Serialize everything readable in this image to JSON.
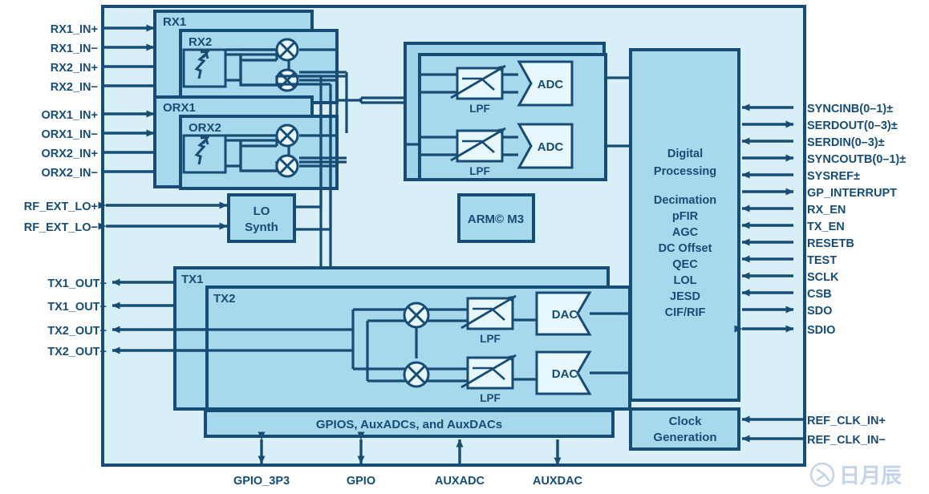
{
  "meta": {
    "title": "RF Transceiver Functional Block Diagram",
    "colors": {
      "outline": "#174c74",
      "die_background": "#d8eff7",
      "block_fill": "#a8d8ec",
      "pale_fill": "#e4f4fb",
      "text": "#174c74",
      "watermark": "#b9cde4",
      "page": "#ffffff"
    }
  },
  "left_inputs": [
    {
      "label": "RX1_IN+",
      "direction": "in"
    },
    {
      "label": "RX1_IN−",
      "direction": "in"
    },
    {
      "label": "RX2_IN+",
      "direction": "in"
    },
    {
      "label": "RX2_IN−",
      "direction": "in"
    },
    {
      "label": "ORX1_IN+",
      "direction": "in"
    },
    {
      "label": "ORX1_IN−",
      "direction": "in"
    },
    {
      "label": "ORX2_IN+",
      "direction": "in"
    },
    {
      "label": "ORX2_IN−",
      "direction": "in"
    }
  ],
  "left_lo": [
    {
      "label": "RF_EXT_LO+",
      "direction": "bidir"
    },
    {
      "label": "RF_EXT_LO−",
      "direction": "bidir"
    }
  ],
  "left_outputs": [
    {
      "label": "TX1_OUT+",
      "direction": "out"
    },
    {
      "label": "TX1_OUT−",
      "direction": "out"
    },
    {
      "label": "TX2_OUT+",
      "direction": "out"
    },
    {
      "label": "TX2_OUT−",
      "direction": "out"
    }
  ],
  "right_signals": [
    {
      "label": "SYNCINB(0–1)±",
      "direction": "in"
    },
    {
      "label": "SERDOUT(0–3)±",
      "direction": "out"
    },
    {
      "label": "SERDIN(0–3)±",
      "direction": "in"
    },
    {
      "label": "SYNCOUTB(0–1)±",
      "direction": "out"
    },
    {
      "label": "SYSREF±",
      "direction": "in"
    },
    {
      "label": "GP_INTERRUPT",
      "direction": "out"
    },
    {
      "label": "RX_EN",
      "direction": "in"
    },
    {
      "label": "TX_EN",
      "direction": "in"
    },
    {
      "label": "RESETB",
      "direction": "in"
    },
    {
      "label": "TEST",
      "direction": "in"
    },
    {
      "label": "SCLK",
      "direction": "in"
    },
    {
      "label": "CSB",
      "direction": "in"
    },
    {
      "label": "SDO",
      "direction": "out"
    },
    {
      "label": "SDIO",
      "direction": "bidir"
    }
  ],
  "right_clock_signals": [
    {
      "label": "REF_CLK_IN+",
      "direction": "in"
    },
    {
      "label": "REF_CLK_IN−",
      "direction": "in"
    }
  ],
  "bottom_signals": [
    {
      "label": "GPIO_3P3",
      "direction": "bidir"
    },
    {
      "label": "GPIO",
      "direction": "bidir"
    },
    {
      "label": "AUXADC",
      "direction": "in"
    },
    {
      "label": "AUXDAC",
      "direction": "out"
    }
  ],
  "blocks": {
    "rx1": "RX1",
    "rx2": "RX2",
    "orx1": "ORX1",
    "orx2": "ORX2",
    "lo_synth_line1": "LO",
    "lo_synth_line2": "Synth",
    "tx1": "TX1",
    "tx2": "TX2",
    "arm": "ARM© M3",
    "gpio_bar": "GPIOS, AuxADCs, and AuxDACs",
    "clock_line1": "Clock",
    "clock_line2": "Generation",
    "adc": "ADC",
    "dac": "DAC",
    "lpf": "LPF"
  },
  "digital_processing": {
    "heading": [
      "Digital",
      "Processing"
    ],
    "features": [
      "Decimation",
      "pFIR",
      "AGC",
      "DC Offset",
      "QEC",
      "LOL",
      "JESD",
      "CIF/RIF"
    ]
  },
  "watermark": {
    "text": "日月辰",
    "mark": "ⓡ"
  }
}
